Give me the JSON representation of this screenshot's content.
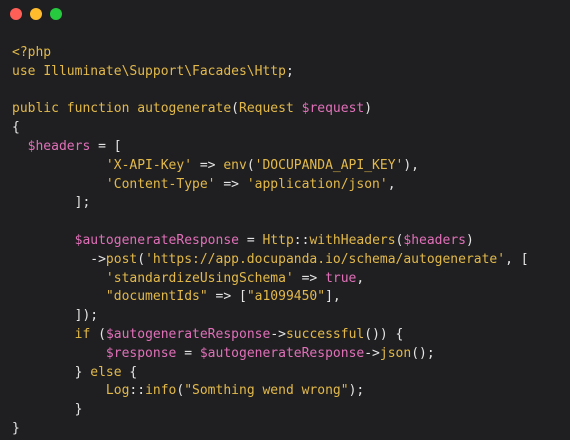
{
  "window": {
    "controls": [
      "close",
      "minimize",
      "maximize"
    ]
  },
  "colors": {
    "background": "#1f1f22",
    "keyword": "#e2b94a",
    "variable": "#e070b8",
    "text": "#e5e5e5"
  },
  "code": {
    "lines": [
      [
        {
          "t": "<?php",
          "c": "kw"
        }
      ],
      [
        {
          "t": "use ",
          "c": "kw"
        },
        {
          "t": "Illuminate\\Support\\Facades\\Http",
          "c": "cls"
        },
        {
          "t": ";",
          "c": "def"
        }
      ],
      [],
      [
        {
          "t": "public ",
          "c": "kw"
        },
        {
          "t": "function ",
          "c": "kw"
        },
        {
          "t": "autogenerate",
          "c": "fn"
        },
        {
          "t": "(",
          "c": "def"
        },
        {
          "t": "Request ",
          "c": "cls"
        },
        {
          "t": "$request",
          "c": "var"
        },
        {
          "t": ")",
          "c": "def"
        }
      ],
      [
        {
          "t": "{",
          "c": "def"
        }
      ],
      [
        {
          "t": "  ",
          "c": "def"
        },
        {
          "t": "$headers",
          "c": "var"
        },
        {
          "t": " = [",
          "c": "def"
        }
      ],
      [
        {
          "t": "            ",
          "c": "def"
        },
        {
          "t": "'X-API-Key'",
          "c": "str"
        },
        {
          "t": " => ",
          "c": "def"
        },
        {
          "t": "env",
          "c": "fn"
        },
        {
          "t": "(",
          "c": "def"
        },
        {
          "t": "'DOCUPANDA_API_KEY'",
          "c": "str"
        },
        {
          "t": "),",
          "c": "def"
        }
      ],
      [
        {
          "t": "            ",
          "c": "def"
        },
        {
          "t": "'Content-Type'",
          "c": "str"
        },
        {
          "t": " => ",
          "c": "def"
        },
        {
          "t": "'application/json'",
          "c": "str"
        },
        {
          "t": ",",
          "c": "def"
        }
      ],
      [
        {
          "t": "        ];",
          "c": "def"
        }
      ],
      [],
      [
        {
          "t": "        ",
          "c": "def"
        },
        {
          "t": "$autogenerateResponse",
          "c": "var"
        },
        {
          "t": " = ",
          "c": "def"
        },
        {
          "t": "Http",
          "c": "cls"
        },
        {
          "t": "::",
          "c": "def"
        },
        {
          "t": "withHeaders",
          "c": "fn"
        },
        {
          "t": "(",
          "c": "def"
        },
        {
          "t": "$headers",
          "c": "var"
        },
        {
          "t": ")",
          "c": "def"
        }
      ],
      [
        {
          "t": "          ->",
          "c": "def"
        },
        {
          "t": "post",
          "c": "fn"
        },
        {
          "t": "(",
          "c": "def"
        },
        {
          "t": "'https://app.docupanda.io/schema/autogenerate'",
          "c": "str"
        },
        {
          "t": ", [",
          "c": "def"
        }
      ],
      [
        {
          "t": "            ",
          "c": "def"
        },
        {
          "t": "'standardizeUsingSchema'",
          "c": "str"
        },
        {
          "t": " => ",
          "c": "def"
        },
        {
          "t": "true",
          "c": "var"
        },
        {
          "t": ",",
          "c": "def"
        }
      ],
      [
        {
          "t": "            ",
          "c": "def"
        },
        {
          "t": "\"documentIds\"",
          "c": "str"
        },
        {
          "t": " => [",
          "c": "def"
        },
        {
          "t": "\"a1099450\"",
          "c": "str"
        },
        {
          "t": "],",
          "c": "def"
        }
      ],
      [
        {
          "t": "        ]);",
          "c": "def"
        }
      ],
      [
        {
          "t": "        ",
          "c": "def"
        },
        {
          "t": "if ",
          "c": "kw"
        },
        {
          "t": "(",
          "c": "def"
        },
        {
          "t": "$autogenerateResponse",
          "c": "var"
        },
        {
          "t": "->",
          "c": "def"
        },
        {
          "t": "successful",
          "c": "fn"
        },
        {
          "t": "()) {",
          "c": "def"
        }
      ],
      [
        {
          "t": "            ",
          "c": "def"
        },
        {
          "t": "$response",
          "c": "var"
        },
        {
          "t": " = ",
          "c": "def"
        },
        {
          "t": "$autogenerateResponse",
          "c": "var"
        },
        {
          "t": "->",
          "c": "def"
        },
        {
          "t": "json",
          "c": "fn"
        },
        {
          "t": "();",
          "c": "def"
        }
      ],
      [
        {
          "t": "        } ",
          "c": "def"
        },
        {
          "t": "else",
          "c": "kw"
        },
        {
          "t": " {",
          "c": "def"
        }
      ],
      [
        {
          "t": "            ",
          "c": "def"
        },
        {
          "t": "Log",
          "c": "cls"
        },
        {
          "t": "::",
          "c": "def"
        },
        {
          "t": "info",
          "c": "fn"
        },
        {
          "t": "(",
          "c": "def"
        },
        {
          "t": "\"Somthing wend wrong\"",
          "c": "str"
        },
        {
          "t": ");",
          "c": "def"
        }
      ],
      [
        {
          "t": "        }",
          "c": "def"
        }
      ],
      [
        {
          "t": "}",
          "c": "def"
        }
      ]
    ]
  }
}
